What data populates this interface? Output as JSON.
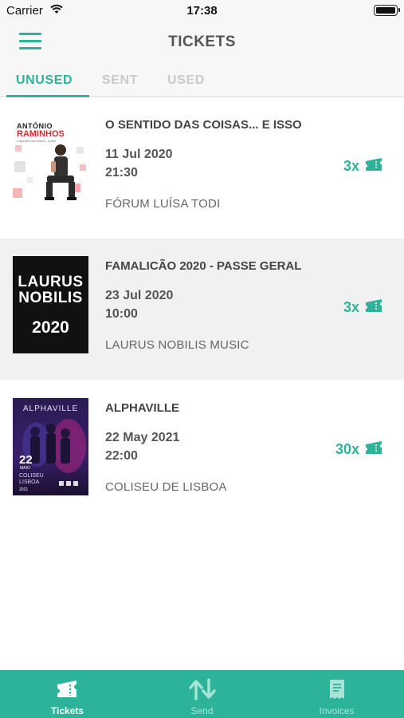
{
  "status_bar": {
    "carrier": "Carrier",
    "time": "17:38"
  },
  "header": {
    "title": "TICKETS"
  },
  "tabs": [
    {
      "label": "UNUSED",
      "active": true
    },
    {
      "label": "SENT",
      "active": false
    },
    {
      "label": "USED",
      "active": false
    }
  ],
  "tickets": [
    {
      "name": "O SENTIDO DAS COISAS... E ISSO",
      "date": "11 Jul 2020",
      "time": "21:30",
      "venue": "FÓRUM LUÍSA TODI",
      "quantity": "3x",
      "poster": {
        "line1": "ANTÓNIO",
        "line2": "RAMINHOS",
        "subtitle": "O SENTIDO DAS COISAS... E ISSO"
      }
    },
    {
      "name": "FAMALICÃO 2020 - PASSE GERAL",
      "date": "23 Jul 2020",
      "time": "10:00",
      "venue": "LAURUS NOBILIS MUSIC",
      "quantity": "3x",
      "poster": {
        "line1": "LAURUS",
        "line2": "NOBILIS",
        "line3": "2020"
      }
    },
    {
      "name": "ALPHAVILLE",
      "date": "22 May 2021",
      "time": "22:00",
      "venue": "COLISEU DE LISBOA",
      "quantity": "30x",
      "poster": {
        "title": "ALPHAVILLE",
        "day": "22",
        "month": "MAIO",
        "venue1": "COLISEU",
        "venue2": "LISBOA",
        "year": "2021"
      }
    }
  ],
  "bottom_nav": [
    {
      "label": "Tickets",
      "icon": "ticket-icon",
      "active": true
    },
    {
      "label": "Send",
      "icon": "send-arrows-icon",
      "active": false
    },
    {
      "label": "Invoices",
      "icon": "receipt-icon",
      "active": false
    }
  ],
  "colors": {
    "accent": "#2db39a",
    "row_shade": "#f1f1f1",
    "tab_inactive": "#c9c9c9"
  }
}
